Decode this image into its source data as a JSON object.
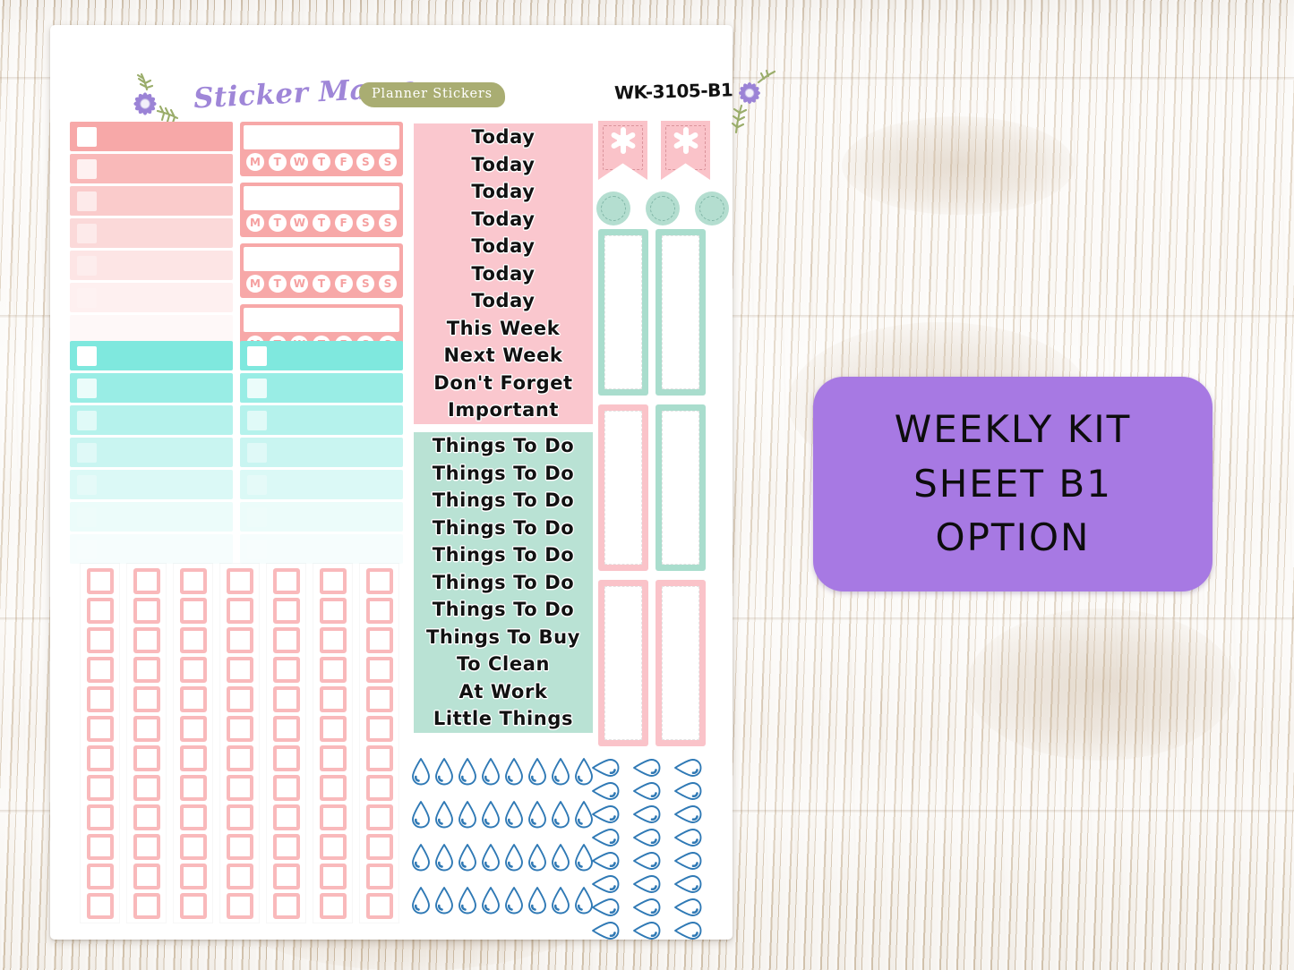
{
  "sheet": {
    "header": {
      "brand": "Sticker Mama",
      "banner": "Planner Stickers",
      "sku": "WK-3105-B1",
      "flower_left": "purple-daisy-icon",
      "flower_right": "purple-daisy-icon"
    },
    "colors": {
      "pink_strong": "#f7a8a8",
      "pink_label": "#fac7ce",
      "pink_frame": "#fac3c9",
      "pink_checkbox": "#f9b9bb",
      "mint_strong": "#7fe8de",
      "mint_label": "#b9e2d4",
      "mint_frame": "#a9ddcd",
      "mint_circle": "#b4ded0",
      "droplet_blue": "#2f79b5",
      "brand_purple": "#9f86d8",
      "banner_olive": "#a9ad72",
      "callout_purple": "#a779e3",
      "sheet_white": "#ffffff"
    },
    "pink_checkbox_bars": {
      "name": "pink-gradient-checkbox-bars",
      "count": 7,
      "opacities": [
        1,
        0.8,
        0.6,
        0.44,
        0.3,
        0.17,
        0.08
      ]
    },
    "habit_trackers": {
      "name": "weekly-habit-tracker",
      "count": 4,
      "days": [
        "M",
        "T",
        "W",
        "T",
        "F",
        "S",
        "S"
      ]
    },
    "mint_checkbox_bars": {
      "name": "mint-gradient-checkbox-bars",
      "columns": 2,
      "count": 7,
      "opacities": [
        1,
        0.8,
        0.58,
        0.42,
        0.28,
        0.15,
        0.07
      ]
    },
    "pink_labels": {
      "name": "pink-header-labels",
      "items": [
        "Today",
        "Today",
        "Today",
        "Today",
        "Today",
        "Today",
        "Today",
        "This Week",
        "Next Week",
        "Don't Forget",
        "Important"
      ]
    },
    "mint_labels": {
      "name": "mint-header-labels",
      "items": [
        "Things To Do",
        "Things To Do",
        "Things To Do",
        "Things To Do",
        "Things To Do",
        "Things To Do",
        "Things To Do",
        "Things To Buy",
        "To Clean",
        "At Work",
        "Little Things"
      ]
    },
    "flags": {
      "name": "pink-flag-banner",
      "count": 2,
      "motif": "flower-star-icon"
    },
    "circles": {
      "name": "mint-dot-sticker",
      "count": 3
    },
    "tall_frames": {
      "name": "tall-frame-sticker",
      "rows": [
        [
          "mint",
          "mint"
        ],
        [
          "pink",
          "mint"
        ],
        [
          "pink",
          "pink"
        ]
      ]
    },
    "checkbox_grid": {
      "name": "pink-checkbox-grid",
      "columns": 7,
      "rows": 12
    },
    "droplet_grid": {
      "name": "water-droplet-grid",
      "columns": 8,
      "rows": 4,
      "icon": "water-drop-icon"
    },
    "droplet_rotated": {
      "name": "rotated-water-droplet-grid",
      "columns": 3,
      "rows": 8,
      "icon": "water-drop-icon"
    }
  },
  "callout": {
    "name": "weekly-kit-callout",
    "lines": [
      "WEEKLY KIT",
      "SHEET B1",
      "OPTION"
    ],
    "background": "#a779e3",
    "text_color": "#0d0d0d"
  }
}
